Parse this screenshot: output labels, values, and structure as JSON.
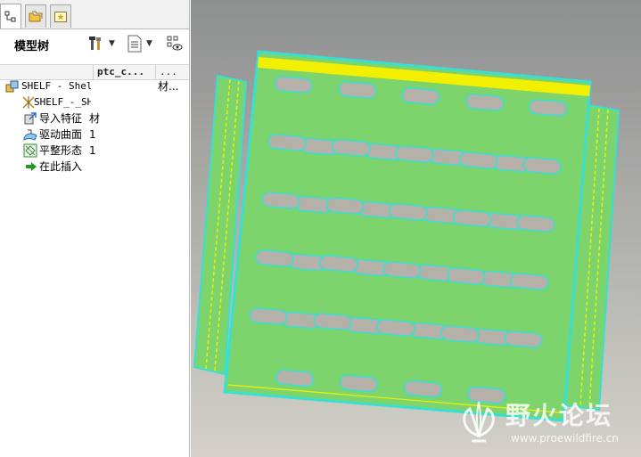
{
  "colors": {
    "part_face": "#7dd46c",
    "part_edge": "#38e0d2",
    "highlight_strip": "#f2ef00",
    "slot_fill": "#b6b1a8",
    "viewport_top": "#8e9090",
    "viewport_bottom": "#d2d0c8"
  },
  "tabs": [
    {
      "icon": "model-tree-icon"
    },
    {
      "icon": "folder-browser-icon"
    },
    {
      "icon": "favorites-icon"
    }
  ],
  "model_tree": {
    "title": "模型树",
    "tools": [
      "settings-hammer-icon",
      "show-list-icon",
      "filter-view-icon"
    ],
    "columns": [
      "ptc_c...",
      "..."
    ],
    "rows": [
      {
        "icon": "part-icon",
        "label": "SHELF - Shelf",
        "value": "材..."
      },
      {
        "icon": "coordinate-system-icon",
        "label": "SHELF_-_SH",
        "value": ""
      },
      {
        "icon": "import-feature-icon",
        "label": "导入特征",
        "value": "材"
      },
      {
        "icon": "driving-surface-icon",
        "label": "驱动曲面",
        "value": "1"
      },
      {
        "icon": "flat-state-icon",
        "label": "平整形态",
        "value": "1"
      },
      {
        "icon": "insert-here-arrow-icon",
        "label": "在此插入",
        "value": ""
      }
    ]
  },
  "watermark": {
    "title": "野火论坛",
    "url": "www.proewildfire.cn"
  }
}
